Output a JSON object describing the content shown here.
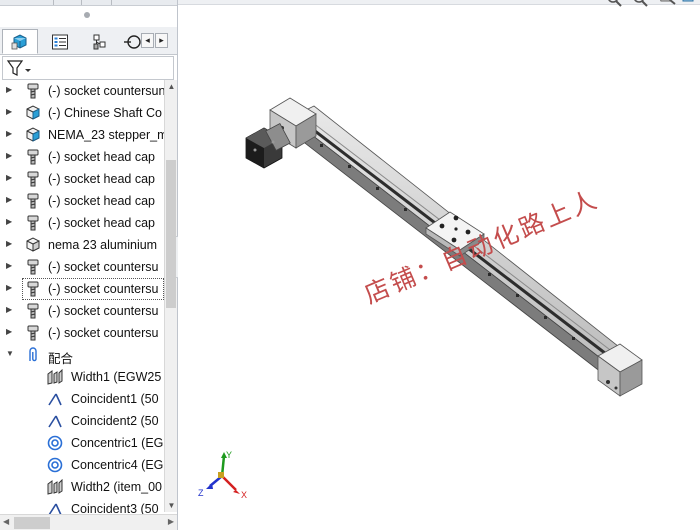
{
  "feature_tree": {
    "tabs": [
      {
        "name": "tab-feature-manager",
        "icon": "assembly-cube-icon"
      },
      {
        "name": "tab-property-manager",
        "icon": "property-list-icon"
      },
      {
        "name": "tab-configuration-manager",
        "icon": "configuration-icon"
      },
      {
        "name": "tab-dimxpert",
        "icon": "crosshair-icon"
      }
    ],
    "filter_icon": "funnel-filter-icon",
    "items": [
      {
        "label": "(-) socket countersunk",
        "icon": "screw-icon",
        "expandable": true,
        "indent": 0
      },
      {
        "label": "(-) Chinese Shaft Co",
        "icon": "part-block-icon",
        "expandable": true,
        "indent": 0
      },
      {
        "label": "NEMA_23 stepper_m",
        "icon": "part-block-icon",
        "expandable": true,
        "indent": 0
      },
      {
        "label": "(-) socket head cap",
        "icon": "screw-icon",
        "expandable": true,
        "indent": 0
      },
      {
        "label": "(-) socket head cap",
        "icon": "screw-icon",
        "expandable": true,
        "indent": 0
      },
      {
        "label": "(-) socket head cap",
        "icon": "screw-icon",
        "expandable": true,
        "indent": 0
      },
      {
        "label": "(-) socket head cap",
        "icon": "screw-icon",
        "expandable": true,
        "indent": 0
      },
      {
        "label": "nema 23 aluminium",
        "icon": "part-white-icon",
        "expandable": true,
        "indent": 0
      },
      {
        "label": "(-) socket countersu",
        "icon": "screw-icon",
        "expandable": true,
        "indent": 0
      },
      {
        "label": "(-) socket countersu",
        "icon": "screw-icon",
        "expandable": true,
        "indent": 0,
        "selected": true
      },
      {
        "label": "(-) socket countersu",
        "icon": "screw-icon",
        "expandable": true,
        "indent": 0
      },
      {
        "label": "(-) socket countersu",
        "icon": "screw-icon",
        "expandable": true,
        "indent": 0
      },
      {
        "label": "配合",
        "icon": "mates-paperclip-icon",
        "expandable": true,
        "expanded": true,
        "indent": 0
      },
      {
        "label": "Width1 (EGW25",
        "icon": "width-mate-icon",
        "indent": 1
      },
      {
        "label": "Coincident1 (50",
        "icon": "coincident-mate-icon",
        "indent": 1
      },
      {
        "label": "Coincident2 (50",
        "icon": "coincident-mate-icon",
        "indent": 1
      },
      {
        "label": "Concentric1 (EG",
        "icon": "concentric-mate-icon",
        "indent": 1
      },
      {
        "label": "Concentric4 (EG",
        "icon": "concentric-mate-icon",
        "indent": 1
      },
      {
        "label": "Width2 (item_00",
        "icon": "width-mate-icon",
        "indent": 1
      },
      {
        "label": "Coincident3 (50",
        "icon": "coincident-mate-icon",
        "indent": 1
      }
    ]
  },
  "viewport": {
    "model": "linear-slide-actuator",
    "watermark": "店铺：自动化路上人",
    "triad": {
      "x": "X",
      "y": "Y",
      "z": "Z"
    }
  },
  "colors": {
    "watermark": "#c44d4d",
    "axis_x": "#d42020",
    "axis_y": "#1e9a1e",
    "axis_z": "#2233cc",
    "selection_outline": "#555555"
  }
}
